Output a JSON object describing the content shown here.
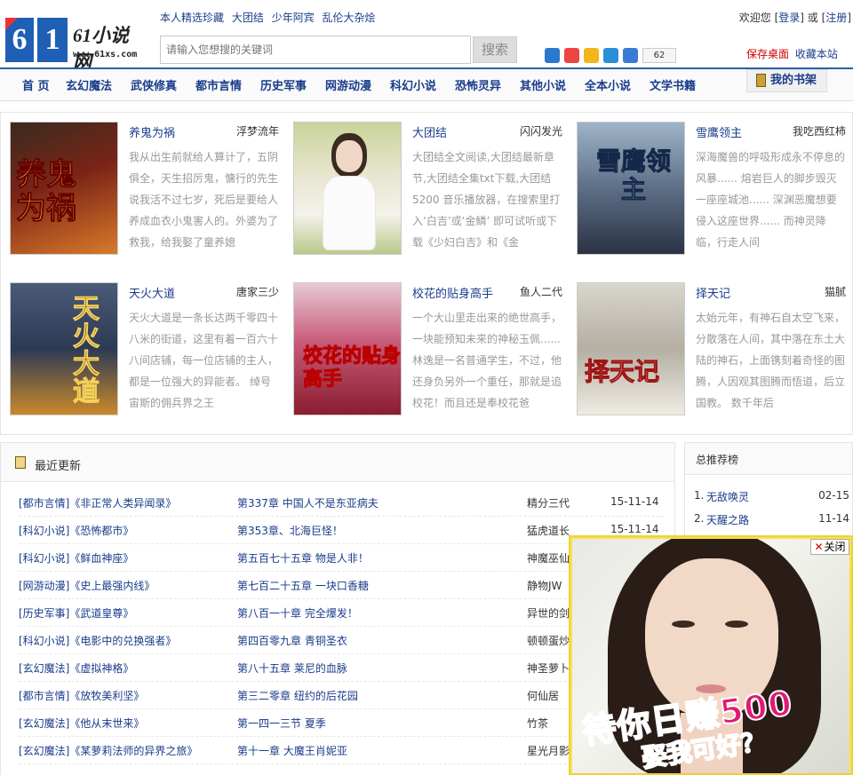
{
  "header": {
    "logo_digits": [
      "6",
      "1"
    ],
    "logo_name": "61小说网",
    "logo_url": "www.61xs.com",
    "top_links": [
      "本人精选珍藏",
      "大团结",
      "少年阿宾",
      "乱伦大杂烩"
    ],
    "search_placeholder": "请输入您想搜的关键词",
    "search_button": "搜索",
    "share_count": "62",
    "welcome": "欢迎您",
    "login": "登录",
    "or": "或",
    "register": "注册",
    "save_desktop": "保存桌面",
    "bookmark_site": "收藏本站"
  },
  "nav": {
    "items": [
      "首 页",
      "玄幻魔法",
      "武侠修真",
      "都市言情",
      "历史军事",
      "网游动漫",
      "科幻小说",
      "恐怖灵异",
      "其他小说",
      "全本小说",
      "文学书籍"
    ],
    "bookshelf": "我的书架"
  },
  "featured": [
    {
      "title": "养鬼为祸",
      "author": "浮梦流年",
      "desc": "我从出生前就给人算计了，五阴俱全，天生招厉鬼，慵行的先生说我活不过七岁，死后是要给人养成血衣小鬼害人的。外婆为了救我，给我娶了童养媳",
      "cover_text": "养鬼为祸"
    },
    {
      "title": "大团结",
      "author": "闪闪发光",
      "desc": "大团结全文阅读,大团结最新章节,大团结全集txt下载,大团结5200 音乐播放器，在搜索里打入‘白吉’或‘金鳞’ 即可试听或下载《少妇白吉》和《金",
      "cover_text": ""
    },
    {
      "title": "雪鹰领主",
      "author": "我吃西红柿",
      "desc": "深海魔兽的呼吸形成永不停息的风暴...... 熔岩巨人的脚步毁灭一座座城池...... 深渊恶魔想要侵入这座世界...... 而神灵降临，行走人间",
      "cover_text": "雪鹰领主"
    },
    {
      "title": "天火大道",
      "author": "唐家三少",
      "desc": "天火大道是一条长达两千零四十八米的街道，这里有着一百六十八间店铺，每一位店铺的主人，都是一位强大的异能者。 绰号宙斯的佣兵界之王",
      "cover_text": "天火大道"
    },
    {
      "title": "校花的贴身高手",
      "author": "鱼人二代",
      "desc": "一个大山里走出来的绝世高手，一块能预知未来的神秘玉佩......林逸是一名普通学生，不过，他还身负另外一个重任，那就是追校花！而且还是奉校花爸",
      "cover_text": "校花的贴身高手"
    },
    {
      "title": "择天记",
      "author": "猫腻",
      "desc": "太始元年，有神石自太空飞来，分散落在人间，其中落在东土大陆的神石，上面镌刻着奇怪的图腾，人因观其图腾而悟道，后立国教。 数千年后",
      "cover_text": "择天记"
    }
  ],
  "latest": {
    "title": "最近更新",
    "rows": [
      {
        "cat": "[都市言情]《非正常人类异闻录》",
        "chap": "第337章 中国人不是东亚病夫",
        "author": "精分三代",
        "date": "15-11-14"
      },
      {
        "cat": "[科幻小说]《恐怖都市》",
        "chap": "第353章、北海巨怪！",
        "author": "猛虎道长",
        "date": "15-11-14"
      },
      {
        "cat": "[科幻小说]《鲜血神座》",
        "chap": "第五百七十五章 物是人非！",
        "author": "神魔巫仙",
        "date": ""
      },
      {
        "cat": "[网游动漫]《史上最强内线》",
        "chap": "第七百二十五章 一块口香糖",
        "author": "静物JW",
        "date": ""
      },
      {
        "cat": "[历史军事]《武道皇尊》",
        "chap": "第八百一十章 完全爆发！",
        "author": "异世的剑",
        "date": ""
      },
      {
        "cat": "[科幻小说]《电影中的兑换强者》",
        "chap": "第四百零九章 青铜圣衣",
        "author": "顿顿蛋炒",
        "date": ""
      },
      {
        "cat": "[玄幻魔法]《虚拟神格》",
        "chap": "第八十五章 莱尼的血脉",
        "author": "神圣萝卜",
        "date": ""
      },
      {
        "cat": "[都市言情]《放牧美利坚》",
        "chap": "第三二零章 纽约的后花园",
        "author": "何仙居",
        "date": ""
      },
      {
        "cat": "[玄幻魔法]《他从末世来》",
        "chap": "第一四一三节 夏季",
        "author": "竹茶",
        "date": ""
      },
      {
        "cat": "[玄幻魔法]《某萝莉法师的异界之旅》",
        "chap": "第十一章 大魔王肖妮亚",
        "author": "星光月影",
        "date": ""
      }
    ]
  },
  "rank": {
    "title": "总推荐榜",
    "items": [
      {
        "n": "1.",
        "t": "无敌唤灵",
        "d": "02-15"
      },
      {
        "n": "2.",
        "t": "天醒之路",
        "d": "11-14"
      }
    ]
  },
  "ad": {
    "close_x": "✕",
    "close": "关闭",
    "line1": "待你日赚500",
    "line2": "娶我可好？"
  }
}
